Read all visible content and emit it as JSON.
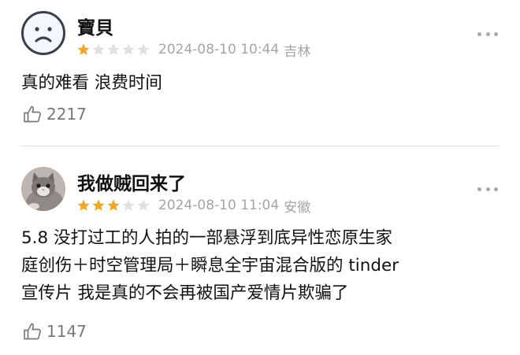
{
  "reviews": [
    {
      "username": "寶貝",
      "avatar": "sad-face-avatar",
      "rating": 1,
      "max_rating": 5,
      "date": "2024-08-10 10:44",
      "location": "吉林",
      "content_lines": [
        "真的难看 浪费时间"
      ],
      "likes": "2217"
    },
    {
      "username": "我做贼回来了",
      "avatar": "cat-photo-avatar",
      "rating": 3,
      "max_rating": 5,
      "date": "2024-08-10 11:04",
      "location": "安徽",
      "content_lines": [
        "5.8 没打过工的人拍的一部悬浮到底异性恋原生家",
        "庭创伤＋时空管理局＋瞬息全宇宙混合版的 tinder",
        "宣传片 我是真的不会再被国产爱情片欺骗了"
      ],
      "likes": "1147"
    }
  ],
  "colors": {
    "star_filled": "#f5a623",
    "star_empty": "#e0e0e0",
    "meta_text": "#a4a4a4",
    "divider": "#e2e2e2"
  },
  "icons": {
    "like": "thumbs-up-icon",
    "more": "more-dots-icon",
    "star": "star-icon"
  }
}
